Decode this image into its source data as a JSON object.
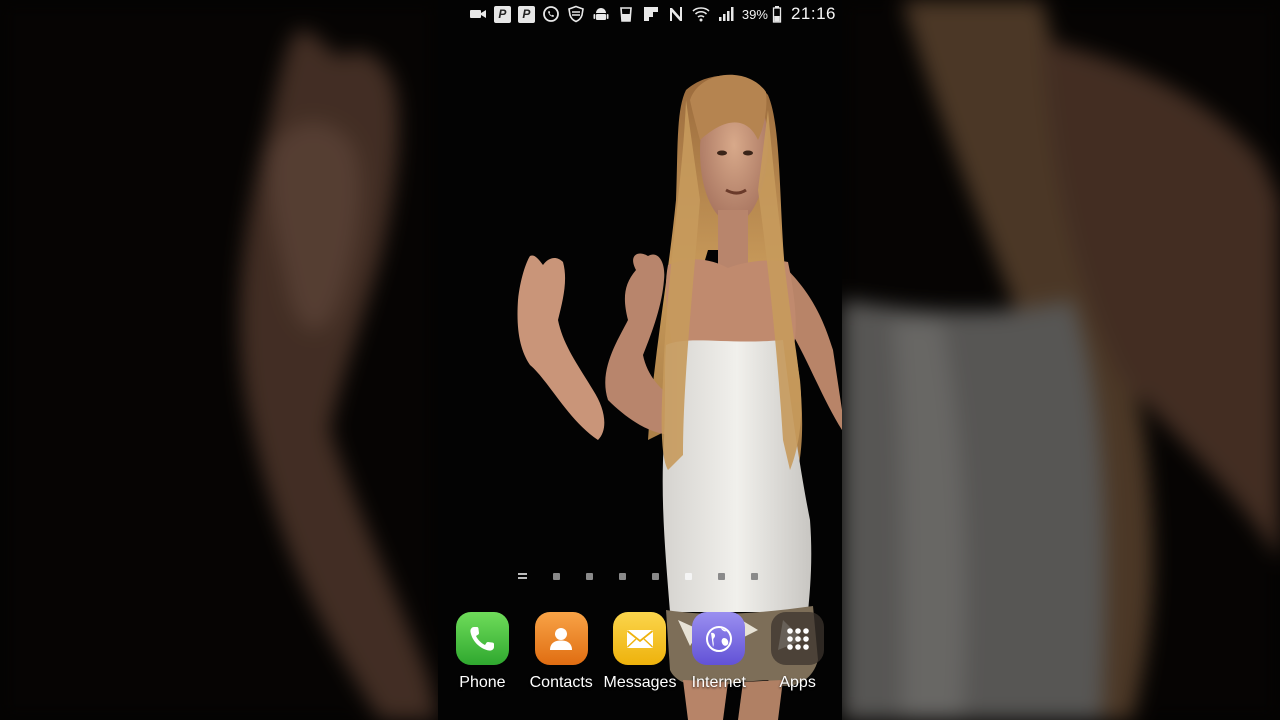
{
  "status_bar": {
    "icons": [
      "video-camera-icon",
      "p-app-icon",
      "p-app-icon-2",
      "whatsapp-icon",
      "shield-icon",
      "android-icon",
      "cup-icon",
      "flipboard-icon",
      "nfc-icon",
      "wifi-icon",
      "signal-icon"
    ],
    "p_label_1": "P",
    "p_label_2": "P",
    "battery_percent": "39%",
    "time": "21:16"
  },
  "home": {
    "page_count": 8,
    "active_page_index": 5
  },
  "dock": {
    "apps": [
      {
        "label": "Phone",
        "icon": "phone-icon",
        "color": "#3fbf3f"
      },
      {
        "label": "Contacts",
        "icon": "contacts-icon",
        "color": "#f08a28"
      },
      {
        "label": "Messages",
        "icon": "envelope-icon",
        "color": "#f4c21f"
      },
      {
        "label": "Internet",
        "icon": "globe-icon",
        "color": "#7a6fe0"
      },
      {
        "label": "Apps",
        "icon": "apps-grid-icon",
        "color": "#5a5048"
      }
    ]
  }
}
